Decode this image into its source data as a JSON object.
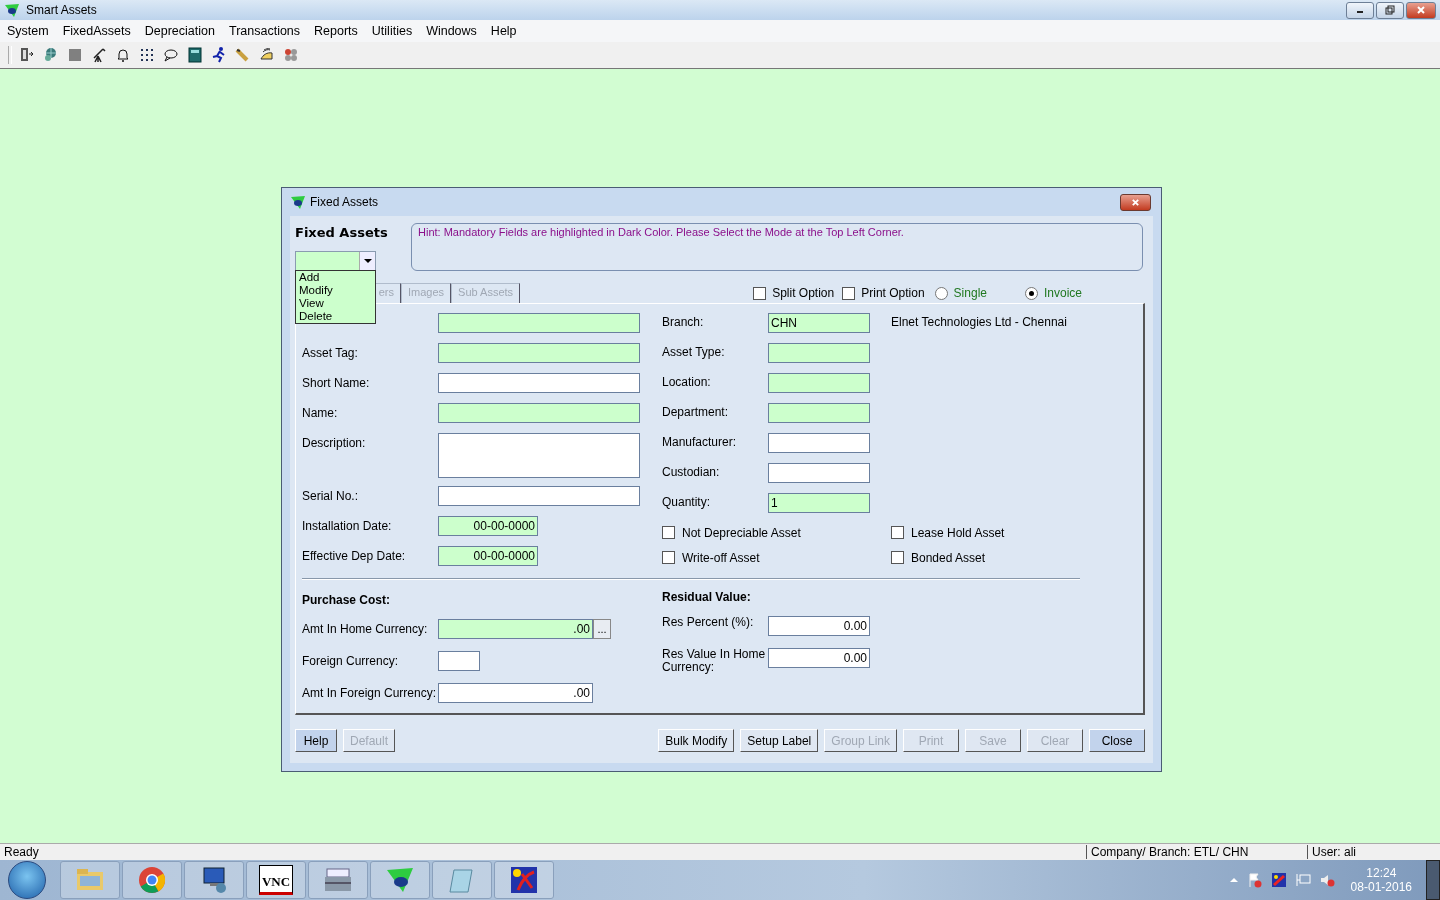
{
  "app": {
    "title": "Smart Assets"
  },
  "menu": [
    "System",
    "FixedAssets",
    "Depreciation",
    "Transactions",
    "Reports",
    "Utilities",
    "Windows",
    "Help"
  ],
  "dialog": {
    "title": "Fixed Assets",
    "heading": "Fixed Assets",
    "hint": "Hint: Mandatory Fields are highlighted in Dark Color. Please Select the Mode at the Top Left Corner.",
    "mode_menu": [
      {
        "label": "Add",
        "selected": false
      },
      {
        "label": "Modify",
        "selected": false
      },
      {
        "label": "View",
        "selected": false
      },
      {
        "label": "Delete",
        "selected": false
      }
    ],
    "tabs": [
      {
        "label": "ers",
        "disabled": true
      },
      {
        "label": "Images",
        "disabled": true
      },
      {
        "label": "Sub Assets",
        "disabled": true
      }
    ],
    "options": [
      {
        "kind": "checkbox",
        "label": "Split Option",
        "checked": false
      },
      {
        "kind": "checkbox",
        "label": "Print Option",
        "checked": false
      },
      {
        "kind": "radio",
        "label": "Single",
        "selected": false
      },
      {
        "kind": "radio",
        "label": "Invoice",
        "selected": true
      }
    ],
    "general_fields": [
      {
        "kind": "text",
        "mandatory": true
      },
      {
        "kind": "text",
        "label": "Asset Tag:",
        "mandatory": true
      },
      {
        "kind": "text",
        "label": "Short Name:",
        "mandatory": false
      },
      {
        "kind": "text",
        "label": "Name:",
        "mandatory": true
      },
      {
        "kind": "textarea",
        "label": "Description:",
        "mandatory": false
      },
      {
        "kind": "text",
        "label": "Serial No.:",
        "mandatory": false
      },
      {
        "kind": "date",
        "label": "Installation Date:",
        "value": "00-00-0000",
        "mandatory": true
      },
      {
        "kind": "date",
        "label": "Effective Dep Date:",
        "value": "00-00-0000",
        "mandatory": true
      }
    ],
    "location_fields": [
      {
        "label": "Branch:",
        "value": "CHN",
        "mandatory": true
      },
      {
        "label": "Asset Type:",
        "mandatory": true
      },
      {
        "label": "Location:",
        "mandatory": true
      },
      {
        "label": "Department:",
        "mandatory": true
      },
      {
        "label": "Manufacturer:",
        "mandatory": false
      },
      {
        "label": "Custodian:",
        "mandatory": false
      },
      {
        "label": "Quantity:",
        "value": "1",
        "mandatory": true
      }
    ],
    "company_name": "Elnet Technologies Ltd - Chennai",
    "flags": [
      {
        "label": "Not Depreciable Asset",
        "checked": false
      },
      {
        "label": "Write-off Asset",
        "checked": false
      },
      {
        "label": "Lease Hold Asset",
        "checked": false
      },
      {
        "label": "Bonded Asset",
        "checked": false
      }
    ],
    "purchase_cost": {
      "heading": "Purchase Cost:",
      "fields": [
        {
          "kind": "amount",
          "label": "Amt In Home Currency:",
          "value": ".00",
          "mandatory": true,
          "button": "..."
        },
        {
          "kind": "code",
          "label": "Foreign Currency:",
          "mandatory": false
        },
        {
          "kind": "amount",
          "label": "Amt In Foreign Currency:",
          "value": ".00",
          "mandatory": false
        }
      ]
    },
    "residual_value": {
      "heading": "Residual Value:",
      "fields": [
        {
          "label": "Res Percent (%):",
          "value": "0.00",
          "mandatory": false
        },
        {
          "label": "Res Value In Home Currency:",
          "value": "0.00",
          "mandatory": false
        }
      ]
    },
    "buttons_left": [
      {
        "label": "Help",
        "disabled": false,
        "highlighted": true
      },
      {
        "label": "Default",
        "disabled": true,
        "highlighted": false
      }
    ],
    "buttons_right": [
      {
        "label": "Bulk Modify",
        "disabled": false,
        "highlighted": false
      },
      {
        "label": "Setup Label",
        "disabled": false,
        "highlighted": false
      },
      {
        "label": "Group Link",
        "disabled": true,
        "highlighted": false
      },
      {
        "label": "Print",
        "disabled": true,
        "highlighted": false
      },
      {
        "label": "Save",
        "disabled": true,
        "highlighted": false
      },
      {
        "label": "Clear",
        "disabled": true,
        "highlighted": false
      },
      {
        "label": "Close",
        "disabled": false,
        "highlighted": true
      }
    ]
  },
  "status_bar": {
    "message": "Ready",
    "company": "Company/ Branch: ETL/ CHN",
    "user": "User: ali"
  },
  "taskbar": {
    "apps": [
      {
        "kind": "folder"
      },
      {
        "kind": "browser"
      },
      {
        "kind": "remote"
      },
      {
        "kind": "vnc",
        "label": "VNC"
      },
      {
        "kind": "toolbox"
      },
      {
        "kind": "assets"
      },
      {
        "kind": "notepad"
      },
      {
        "kind": "paint"
      }
    ],
    "time": "12:24",
    "date": "08-01-2016"
  }
}
